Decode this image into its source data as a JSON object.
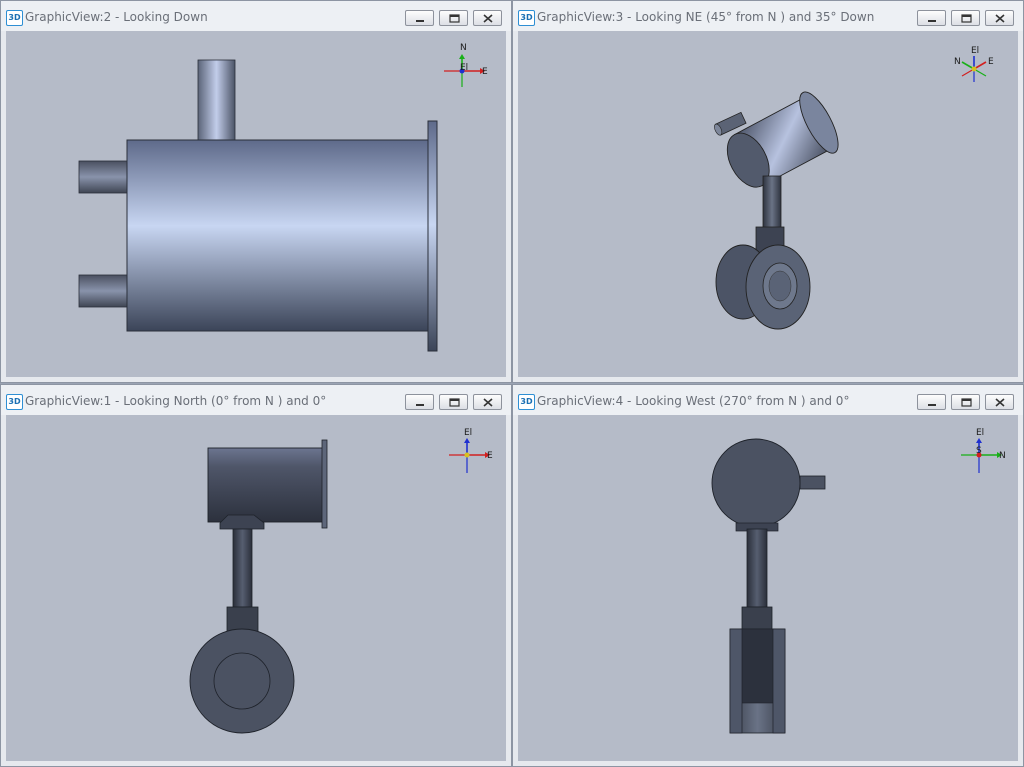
{
  "windows": [
    {
      "id": "view2",
      "badge": "3D",
      "title": "GraphicView:2 - Looking Down",
      "axes": {
        "labels": [
          "N",
          "El",
          "E"
        ]
      }
    },
    {
      "id": "view3",
      "badge": "3D",
      "title": "GraphicView:3 - Looking NE (45° from N ) and 35° Down",
      "axes": {
        "labels": [
          "El",
          "N",
          "E"
        ]
      }
    },
    {
      "id": "view1",
      "badge": "3D",
      "title": "GraphicView:1 - Looking North (0° from N ) and 0°",
      "axes": {
        "labels": [
          "El",
          "E"
        ]
      }
    },
    {
      "id": "view4",
      "badge": "3D",
      "title": "GraphicView:4 - Looking West (270° from N ) and 0°",
      "axes": {
        "labels": [
          "El",
          "S",
          "N"
        ]
      }
    }
  ],
  "colors": {
    "viewport_bg": "#b5bbc8",
    "pipe_light": "#c4d2f0",
    "pipe_dark": "#3d4454",
    "axis_x": "#d22020",
    "axis_y": "#19b019",
    "axis_z": "#1e2fd0"
  },
  "icons": [
    "minimize-icon",
    "restore-icon",
    "close-icon",
    "3d-icon",
    "compass-axes-icon"
  ]
}
